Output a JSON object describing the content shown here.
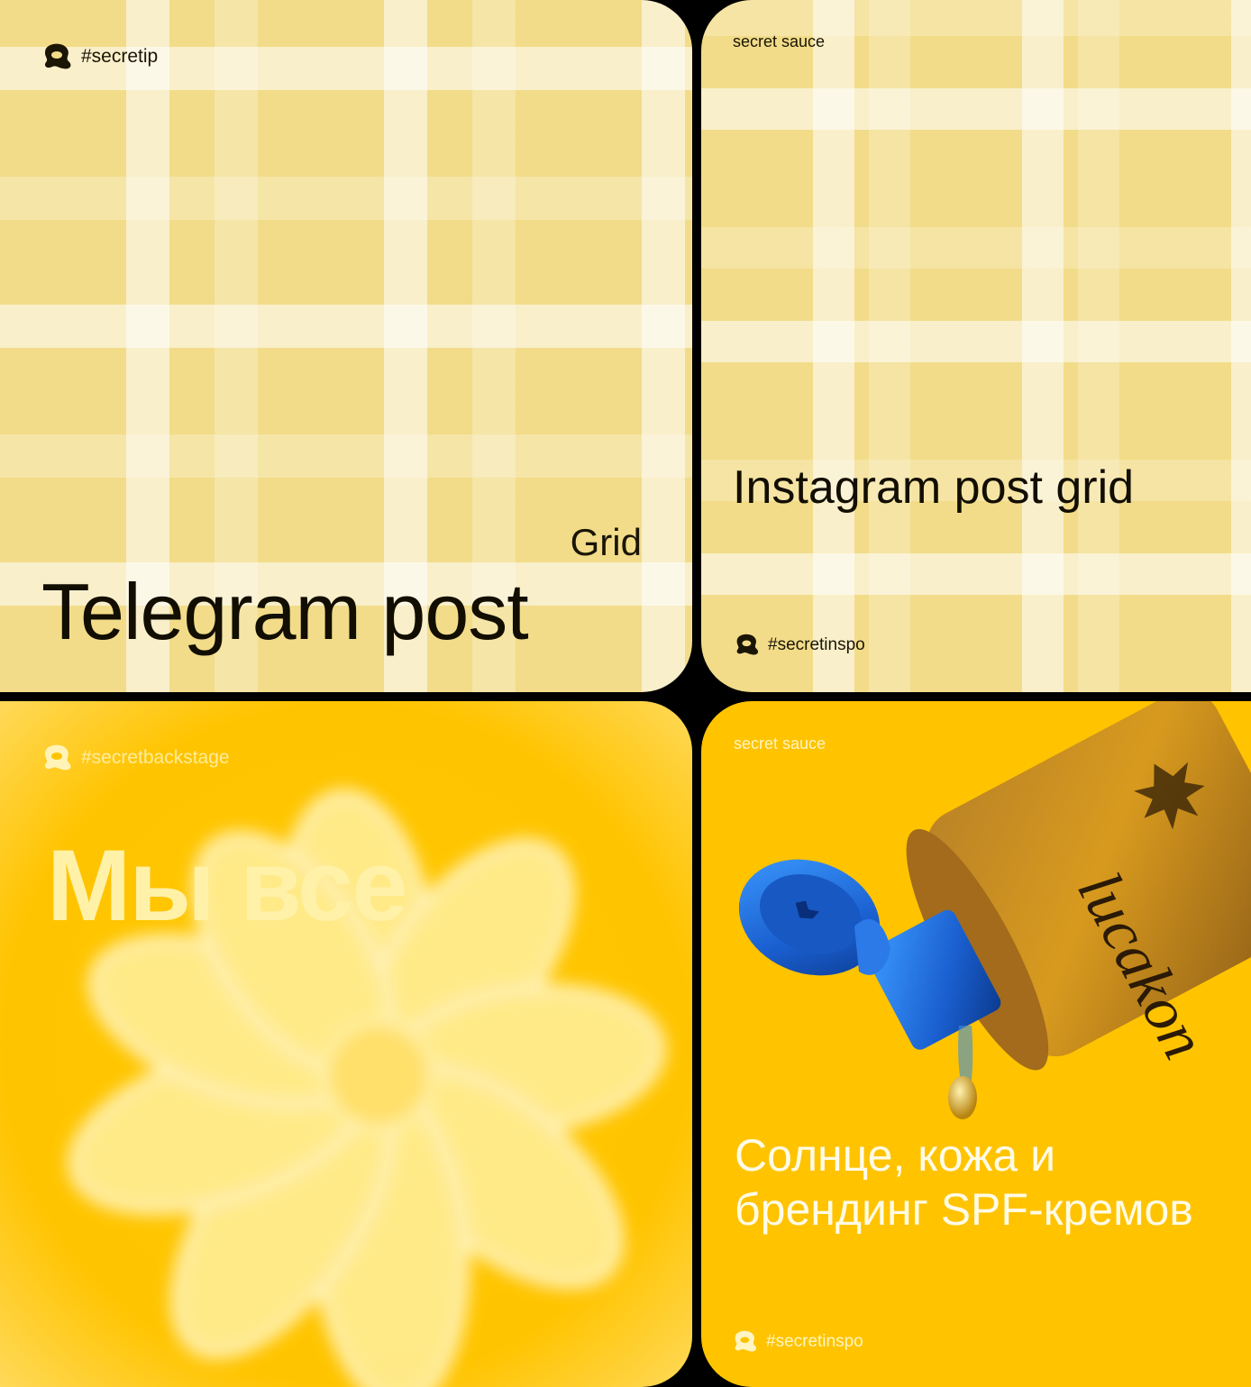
{
  "telegram": {
    "hashtag": "#secretip",
    "grid_word": "Grid",
    "title": "Telegram post"
  },
  "instagram": {
    "brand": "secret sauce",
    "title": "Instagram post grid",
    "hashtag": "#secretinspo"
  },
  "backstage": {
    "hashtag": "#secretbackstage",
    "title": "Мы все"
  },
  "spf": {
    "brand": "secret sauce",
    "title": "Солнце, кожа и брендинг SPF-кремов",
    "hashtag": "#secretinspo"
  },
  "icons": {
    "brand_logo": "blob-logo-icon",
    "flower": "daisy-icon",
    "bottle": "sunscreen-bottle-icon"
  },
  "colors": {
    "pale_yellow": "#f2dc89",
    "sun_yellow": "#ffc300",
    "dark_text": "#120e02",
    "cap_blue": "#1f6fd8"
  }
}
